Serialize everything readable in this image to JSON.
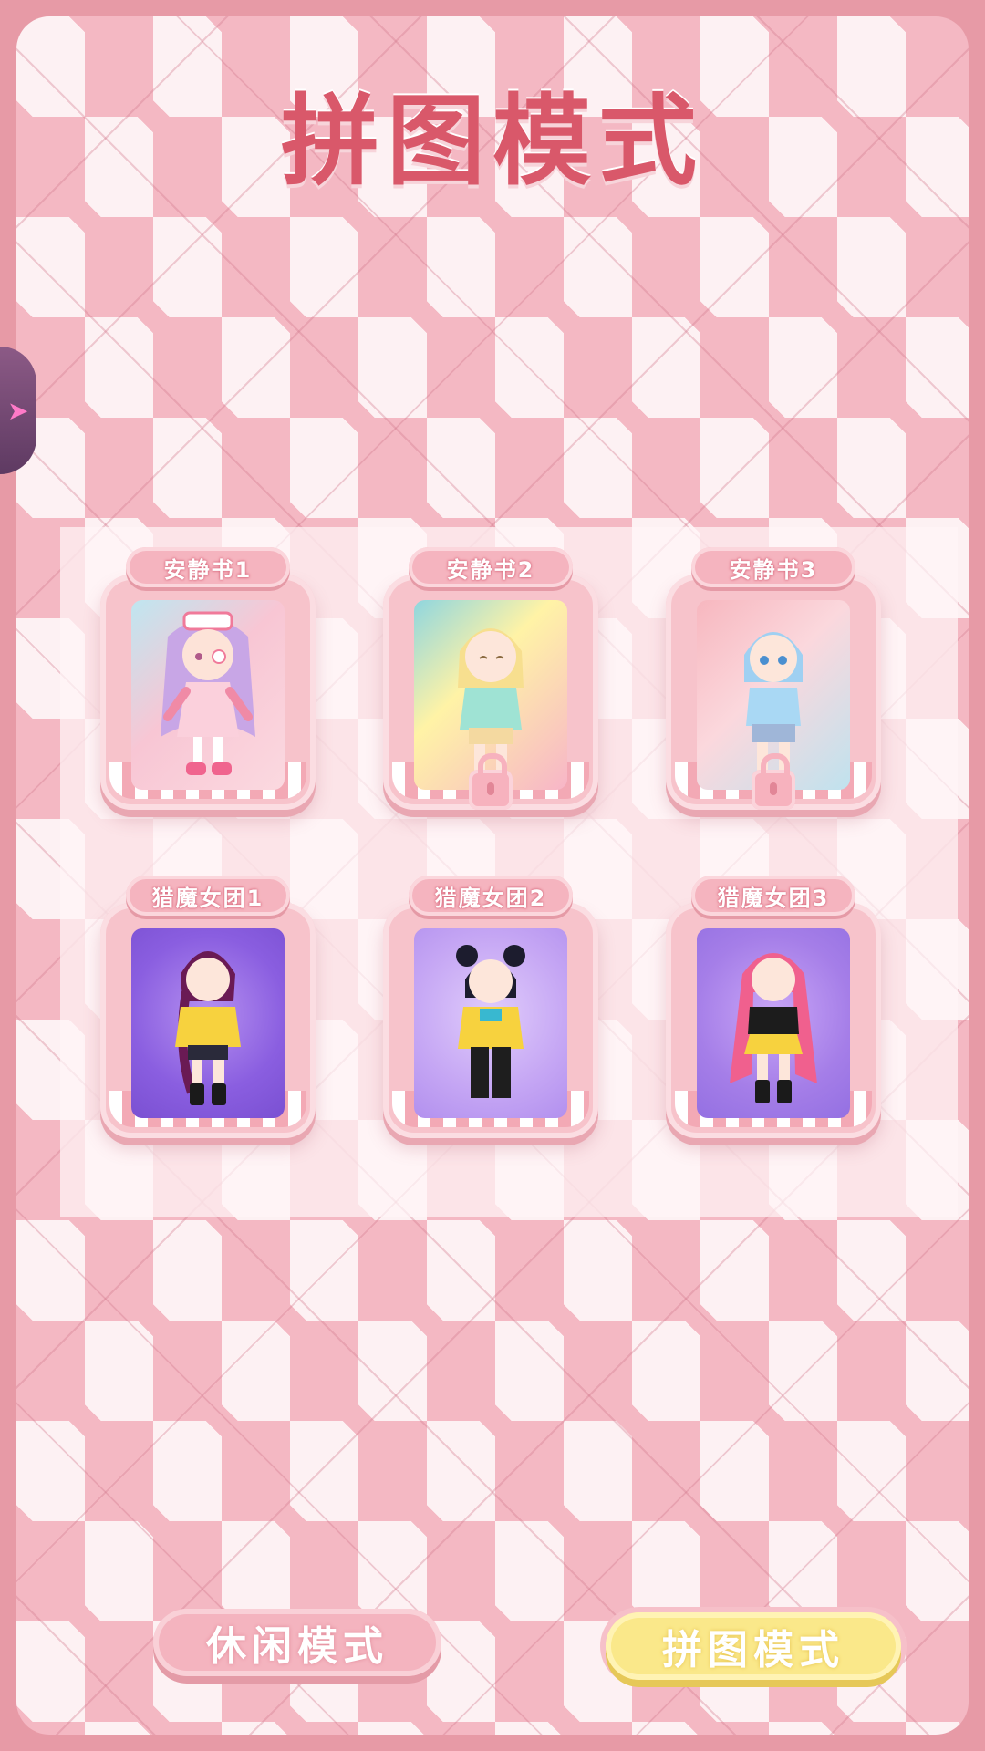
{
  "title": "拼图模式",
  "levels": [
    {
      "label": "安静书1",
      "locked": false
    },
    {
      "label": "安静书2",
      "locked": true
    },
    {
      "label": "安静书3",
      "locked": true
    },
    {
      "label": "猎魔女团1",
      "locked": false
    },
    {
      "label": "猎魔女团2",
      "locked": false
    },
    {
      "label": "猎魔女团3",
      "locked": false
    }
  ],
  "buttons": {
    "casual_mode": "休闲模式",
    "puzzle_mode": "拼图模式"
  },
  "colors": {
    "title": "#d9586a",
    "frame": "#e79aa6",
    "button_active": "#fae88a",
    "button_inactive": "#f4b4bf"
  },
  "icons": {
    "lock": "padlock-icon",
    "side_tab": "chevron-right-icon"
  }
}
